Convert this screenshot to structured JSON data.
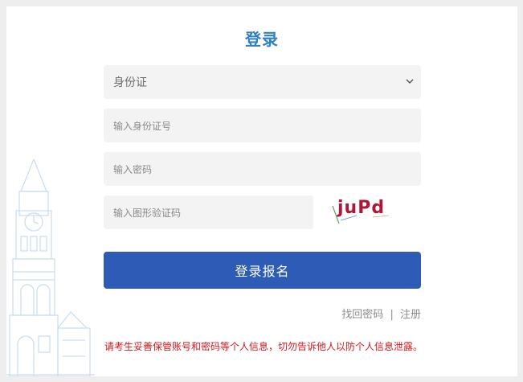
{
  "form": {
    "title": "登录",
    "id_type": {
      "selected": "身份证"
    },
    "id_number": {
      "placeholder": "输入身份证号"
    },
    "password": {
      "placeholder": "输入密码"
    },
    "captcha_input": {
      "placeholder": "输入图形验证码"
    },
    "captcha_image_text": "juPd",
    "submit_label": "登录报名",
    "forgot_password": "找回密码",
    "separator": "|",
    "register": "注册",
    "notice": "请考生妥善保管账号和密码等个人信息，切勿告诉他人以防个人信息泄露。"
  },
  "colors": {
    "title": "#2f7fc4",
    "button": "#2e5bb5",
    "notice": "#d6171a",
    "captcha": "#b0163a",
    "field_bg": "#f3f3f3"
  },
  "icons": {
    "select_arrow": "chevron-down-icon",
    "background_illustration": "clock-tower-illustration"
  }
}
